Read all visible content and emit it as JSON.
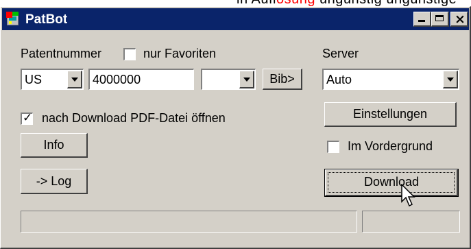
{
  "window": {
    "title": "PatBot"
  },
  "patent": {
    "label": "Patentnummer",
    "favorites_label": "nur Favoriten",
    "favorites_checked": false,
    "country": "US",
    "number": "4000000",
    "kind": "",
    "bib_button": "Bib>"
  },
  "server": {
    "label": "Server",
    "value": "Auto"
  },
  "options": {
    "open_pdf_label": "nach Download PDF-Datei öffnen",
    "open_pdf_checked": true,
    "foreground_label": "Im Vordergrund",
    "foreground_checked": false
  },
  "buttons": {
    "info": "Info",
    "log": "-> Log",
    "settings": "Einstellungen",
    "download": "Download"
  },
  "status": {
    "left": "",
    "right": ""
  },
  "icons": [
    "app-icon",
    "minimize-icon",
    "maximize-icon",
    "close-icon",
    "dropdown-arrow-icon",
    "checkmark-icon",
    "mouse-cursor-icon"
  ],
  "colors": {
    "titlebar": "#0a246a",
    "face": "#d4d0c8"
  }
}
